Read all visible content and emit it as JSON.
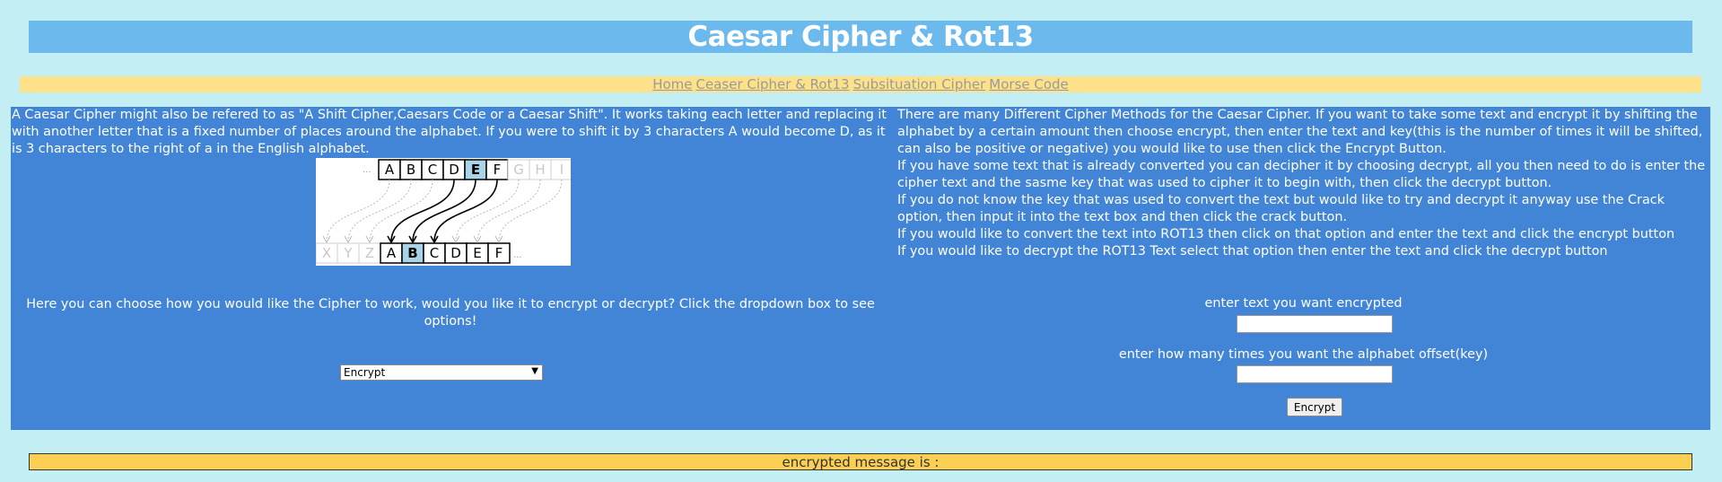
{
  "page": {
    "title": "Caesar Cipher & Rot13"
  },
  "nav": {
    "home": "Home",
    "caesar": "Ceaser Cipher & Rot13",
    "substitution": "Subsituation Cipher",
    "morse": "Morse Code"
  },
  "left": {
    "intro": "A Caesar Cipher might also be refered to as \"A Shift Cipher,Caesars Code or a Caesar Shift\". It works taking each letter and replacing it with another letter that is a fixed number of places around the alphabet. If you were to shift it by 3 characters A would become D, as it is 3 characters to the right of a in the English alphabet.",
    "figure": {
      "top_row": [
        "A",
        "B",
        "C",
        "D",
        "E",
        "F",
        "G",
        "H",
        "I"
      ],
      "bottom_row": [
        "X",
        "Y",
        "Z",
        "A",
        "B",
        "C",
        "D",
        "E",
        "F"
      ],
      "ellipsis": "..."
    },
    "choose_text": "Here you can choose how you would like the Cipher to work, would you like it to encrypt or decrypt? Click the dropdown box to see options!",
    "mode_select": {
      "selected": "Encrypt"
    }
  },
  "right": {
    "paragraphs": [
      "There are many Different Cipher Methods for the Caesar Cipher. If you want to take some text and encrypt it by shifting the alphabet by a certain amount then choose encrypt, then enter the text and key(this is the number of times it will be shifted, can also be positive or negative) you would like to use then click the Encrypt Button.",
      "If you have some text that is already converted you can decipher it by choosing decrypt, all you then need to do is enter the cipher text and the sasme key that was used to cipher it to begin with, then click the decrypt button.",
      "If you do not know the key that was used to convert the text but would like to try and decrypt it anyway use the Crack option, then input it into the text box and then click the crack button.",
      "If you would like to convert the text into ROT13 then click on that option and enter the text and click the encrypt button",
      "If you would like to decrypt the ROT13 Text select that option then enter the text and click the decrypt button"
    ],
    "text_label": "enter text you want encrypted",
    "key_label": "enter how many times you want the alphabet offset(key)",
    "button_label": "Encrypt"
  },
  "result": {
    "label": "encrypted message is :"
  },
  "colors": {
    "background": "#c2eef4",
    "title_bar": "#6cb9ee",
    "nav_bar": "#fde28a",
    "main_panel": "#4285d6",
    "result_bar": "#fbcf52",
    "highlight_cell": "#a9d3e6"
  }
}
